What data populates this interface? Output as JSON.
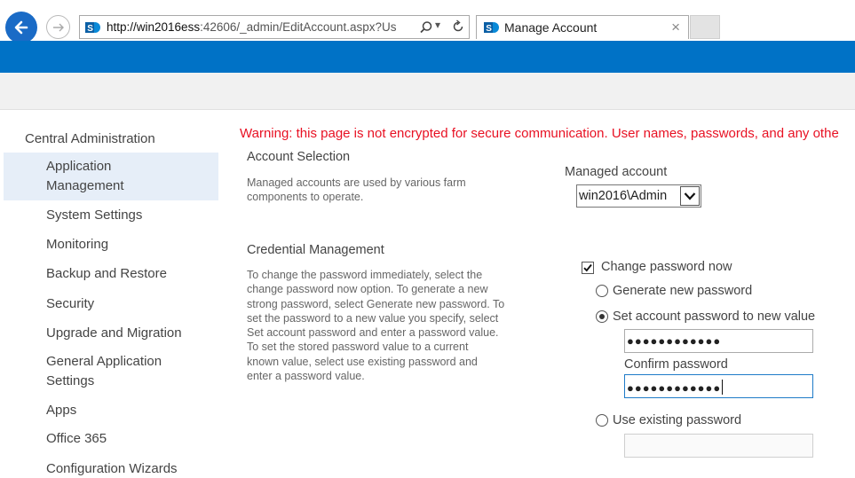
{
  "browser": {
    "url_host": "http://win2016ess",
    "url_rest": ":42606/_admin/EditAccount.aspx?Us",
    "tab_title": "Manage Account",
    "tab_close": "×",
    "address_dropdown": "▾"
  },
  "nav": {
    "root": "Central Administration",
    "items": [
      {
        "label": "Application Management",
        "line1": "Application",
        "line2": "Management",
        "selected": true
      },
      {
        "label": "System Settings"
      },
      {
        "label": "Monitoring"
      },
      {
        "label": "Backup and Restore"
      },
      {
        "label": "Security"
      },
      {
        "label": "Upgrade and Migration"
      },
      {
        "label": "General Application Settings",
        "line1": "General Application",
        "line2": "Settings"
      },
      {
        "label": "Apps"
      },
      {
        "label": "Office 365"
      },
      {
        "label": "Configuration Wizards"
      }
    ]
  },
  "warning": "Warning: this page is not encrypted for secure communication. User names, passwords, and any othe",
  "account_selection": {
    "title": "Account Selection",
    "desc_lines": [
      "Managed accounts are used by various farm",
      "components to operate."
    ],
    "field_label": "Managed account",
    "selected_value": "win2016\\Admin"
  },
  "credential_management": {
    "title": "Credential Management",
    "desc_lines": [
      "To change the password immediately, select the",
      "change password now option. To generate a new",
      "strong password, select Generate new password. To",
      "set the password to a new value you specify, select",
      "Set account password and enter a password value.",
      "To set the stored password value to a current",
      "known value, select use existing password and",
      "enter a password value."
    ],
    "change_now_label": "Change password now",
    "change_now_checked": true,
    "generate_label": "Generate new password",
    "set_label": "Set account password to new value",
    "password_value": "●●●●●●●●●●●●",
    "confirm_label": "Confirm password",
    "confirm_value": "●●●●●●●●●●●●",
    "use_existing_label": "Use existing password",
    "existing_value": ""
  },
  "colors": {
    "suite_bar": "#0072c6",
    "warning": "#e81123",
    "nav_selected": "#e6eef8"
  }
}
